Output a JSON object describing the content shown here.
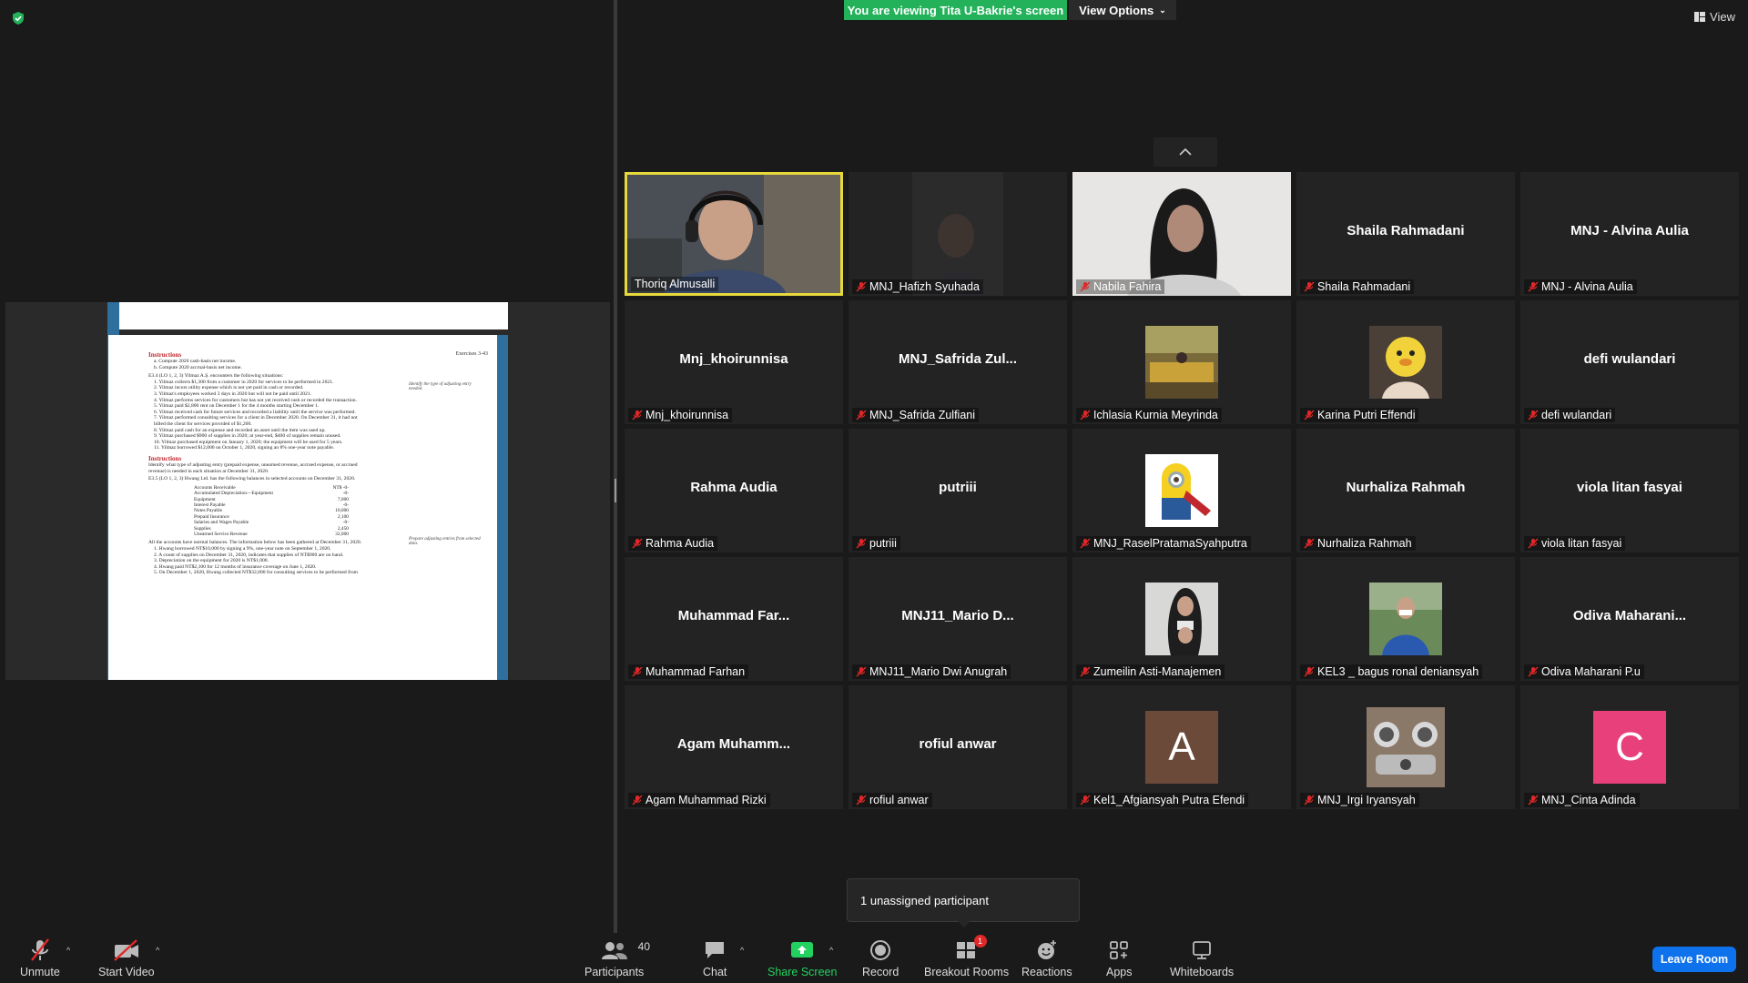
{
  "top": {
    "viewing_banner": "You are viewing Tita U-Bakrie's screen",
    "view_options": "View Options",
    "view_button": "View"
  },
  "document": {
    "header": "Exercises  3-43",
    "instructions_1": "Instructions",
    "lines_1": [
      "a. Compute 2020 cash-basis net income.",
      "b. Compute 2020 accrual-basis net income."
    ],
    "e34_title": "E3.4 (LO 1, 2, 3)  Yilmaz A.Ş. encounters the following situations:",
    "e34_margin": "Identify the type of adjusting entry needed.",
    "e34_items": [
      "1. Yilmaz collects $1,300 from a customer in 2020 for services to be performed in 2021.",
      "2. Yilmaz incurs utility expense which is not yet paid in cash or recorded.",
      "3. Yilmaz's employees worked 3 days in 2020 but will not be paid until 2021.",
      "4. Yilmaz performs services for customers but has not yet received cash or recorded the transaction.",
      "5. Yilmaz paid $2,800 rent on December 1 for the 4 months starting December 1.",
      "6. Yilmaz received cash for future services and recorded a liability until the service was performed.",
      "7. Yilmaz performed consulting services for a client in December 2020. On December 31, it had not",
      "   billed the client for services provided of $1,200.",
      "8. Yilmaz paid cash for an expense and recorded an asset until the item was used up.",
      "9. Yilmaz purchased $900 of supplies in 2020; at year-end, $400 of supplies remain unused.",
      "10. Yilmaz purchased equipment on January 1, 2020; the equipment will be used for 5 years.",
      "11. Yilmaz borrowed $12,000 on October 1, 2020, signing an 8% one-year note payable."
    ],
    "instructions_2": "Instructions",
    "lines_2": [
      "Identify what type of adjusting entry (prepaid expense, unearned revenue, accrued expense, or accrued",
      "revenue) is needed in each situation at December 31, 2020."
    ],
    "e35_title": "E3.5 (LO 1, 2, 3)  Hwang Ltd. has the following balances in selected accounts on December 31, 2020.",
    "e35_margin": "Prepare adjusting entries from selected data.",
    "table": [
      {
        "label": "Accounts Receivable",
        "value": "NT$ -0-"
      },
      {
        "label": "Accumulated Depreciation—Equipment",
        "value": "-0-"
      },
      {
        "label": "Equipment",
        "value": "7,000"
      },
      {
        "label": "Interest Payable",
        "value": "-0-"
      },
      {
        "label": "Notes Payable",
        "value": "10,000"
      },
      {
        "label": "Prepaid Insurance",
        "value": "2,100"
      },
      {
        "label": "Salaries and Wages Payable",
        "value": "-0-"
      },
      {
        "label": "Supplies",
        "value": "2,450"
      },
      {
        "label": "Unearned Service Revenue",
        "value": "32,000"
      }
    ],
    "lines_3": [
      "All the accounts have normal balances. The information below has been gathered at December 31, 2020.",
      "1. Hwang borrowed NT$10,000 by signing a 9%, one-year note on September 1, 2020.",
      "2. A count of supplies on December 31, 2020, indicates that supplies of NT$900 are on hand.",
      "3. Depreciation on the equipment for 2020 is NT$1,000.",
      "4. Hwang paid NT$2,100 for 12 months of insurance coverage on June 1, 2020.",
      "5. On December 1, 2020, Hwang collected NT$32,000 for consulting services to be performed from"
    ]
  },
  "participants": [
    {
      "label": "Thoriq Almusalli",
      "center": "",
      "kind": "video",
      "active": true,
      "muted": false
    },
    {
      "label": "MNJ_Hafizh Syuhada",
      "center": "",
      "kind": "video-dark",
      "active": false,
      "muted": true
    },
    {
      "label": "Nabila Fahira",
      "center": "",
      "kind": "video-light",
      "active": false,
      "muted": true
    },
    {
      "label": "Shaila Rahmadani",
      "center": "Shaila Rahmadani",
      "kind": "name",
      "active": false,
      "muted": true
    },
    {
      "label": "MNJ - Alvina Aulia",
      "center": "MNJ - Alvina Aulia",
      "kind": "name",
      "active": false,
      "muted": true
    },
    {
      "label": "Mnj_khoirunnisa",
      "center": "Mnj_khoirunnisa",
      "kind": "name",
      "active": false,
      "muted": true
    },
    {
      "label": "MNJ_Safrida Zulfiani",
      "center": "MNJ_Safrida  Zul...",
      "kind": "name",
      "active": false,
      "muted": true
    },
    {
      "label": "Ichlasia Kurnia Meyrinda",
      "center": "",
      "kind": "photo-cafe",
      "active": false,
      "muted": true
    },
    {
      "label": "Karina Putri Effendi",
      "center": "",
      "kind": "photo-duck",
      "active": false,
      "muted": true
    },
    {
      "label": "defi wulandari",
      "center": "defi wulandari",
      "kind": "name",
      "active": false,
      "muted": true
    },
    {
      "label": "Rahma Audia",
      "center": "Rahma Audia",
      "kind": "name",
      "active": false,
      "muted": true
    },
    {
      "label": "putriii",
      "center": "putriii",
      "kind": "name",
      "active": false,
      "muted": true
    },
    {
      "label": "MNJ_RaselPratamaSyahputra",
      "center": "",
      "kind": "photo-minion",
      "active": false,
      "muted": true
    },
    {
      "label": "Nurhaliza Rahmah",
      "center": "Nurhaliza Rahmah",
      "kind": "name",
      "active": false,
      "muted": true
    },
    {
      "label": "viola litan fasyai",
      "center": "viola litan fasyai",
      "kind": "name",
      "active": false,
      "muted": true
    },
    {
      "label": "Muhammad Farhan",
      "center": "Muhammad  Far...",
      "kind": "name",
      "active": false,
      "muted": true
    },
    {
      "label": "MNJ11_Mario Dwi Anugrah",
      "center": "MNJ11_Mario  D...",
      "kind": "name",
      "active": false,
      "muted": true
    },
    {
      "label": "Zumeilin Asti-Manajemen",
      "center": "",
      "kind": "photo-hijab",
      "active": false,
      "muted": true
    },
    {
      "label": "KEL3 _ bagus ronal deniansyah",
      "center": "",
      "kind": "photo-boy",
      "active": false,
      "muted": true
    },
    {
      "label": "Odiva Maharani P.u",
      "center": "Odiva  Maharani...",
      "kind": "name",
      "active": false,
      "muted": true
    },
    {
      "label": "Agam Muhammad Rizki",
      "center": "Agam  Muhamm...",
      "kind": "name",
      "active": false,
      "muted": true
    },
    {
      "label": "rofiul anwar",
      "center": "rofiul anwar",
      "kind": "name",
      "active": false,
      "muted": true
    },
    {
      "label": "Kel1_Afgiansyah Putra Efendi",
      "center": "A",
      "kind": "letter",
      "letter_color": "#6b4a3a",
      "active": false,
      "muted": true
    },
    {
      "label": "MNJ_Irgi Iryansyah",
      "center": "",
      "kind": "photo-car",
      "active": false,
      "muted": true
    },
    {
      "label": "MNJ_Cinta Adinda",
      "center": "C",
      "kind": "letter",
      "letter_color": "#e8407a",
      "active": false,
      "muted": true
    }
  ],
  "tooltip": "1 unassigned participant",
  "toolbar": {
    "unmute": "Unmute",
    "start_video": "Start Video",
    "participants": "Participants",
    "participants_count": "40",
    "chat": "Chat",
    "share_screen": "Share Screen",
    "record": "Record",
    "breakout_rooms": "Breakout Rooms",
    "breakout_badge": "1",
    "reactions": "Reactions",
    "apps": "Apps",
    "whiteboards": "Whiteboards",
    "leave_room": "Leave Room"
  },
  "colors": {
    "accent_green": "#23b15a",
    "active_speaker": "#e7d93b",
    "muted_red": "#e02828",
    "leave_blue": "#0e72ed"
  }
}
